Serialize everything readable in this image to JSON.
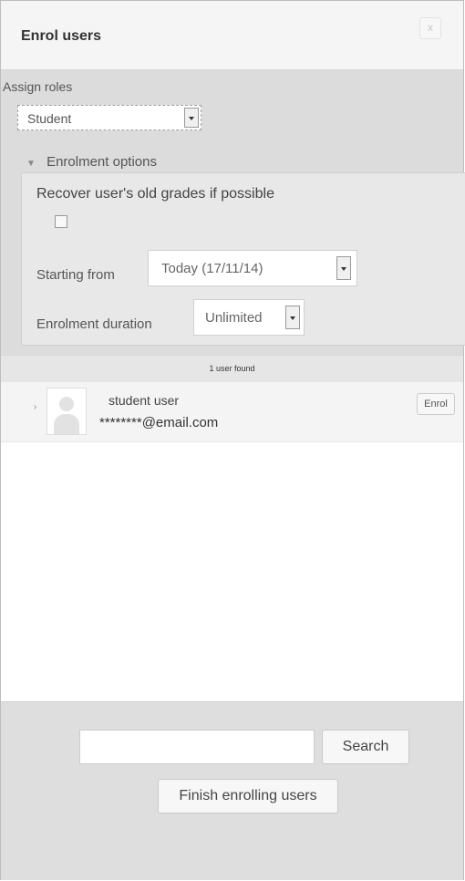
{
  "dialog": {
    "title": "Enrol users",
    "close_icon": "close-icon",
    "close_glyph": "x"
  },
  "assign_roles": {
    "label": "Assign roles",
    "selected": "Student"
  },
  "enrolment_options": {
    "legend": "Enrolment options",
    "recover_grades_label": "Recover user's old grades if possible",
    "recover_grades_checked": false,
    "starting_from_label": "Starting from",
    "starting_from_value": "Today (17/11/14)",
    "duration_label": "Enrolment duration",
    "duration_value": "Unlimited"
  },
  "results": {
    "count_text": "1 user found",
    "users": [
      {
        "name": "student user",
        "email": "********@email.com",
        "enrol_label": "Enrol",
        "avatar_icon": "user-avatar-icon"
      }
    ]
  },
  "footer": {
    "search_value": "",
    "search_label": "Search",
    "finish_label": "Finish enrolling users"
  },
  "colors": {
    "settings_bg": "#dcdcdc",
    "header_bg": "#f5f5f5",
    "row_bg": "#f4f4f4"
  }
}
